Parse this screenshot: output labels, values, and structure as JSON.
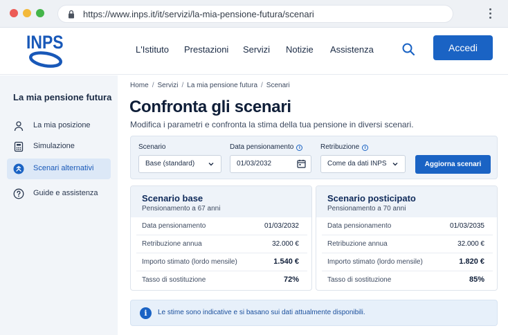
{
  "browser": {
    "url": "https://www.inps.it/it/servizi/la-mia-pensione-futura/scenari"
  },
  "header": {
    "logo_text": "INPS",
    "nav": [
      "L'Istituto",
      "Prestazioni",
      "Servizi",
      "Notizie",
      "Assistenza"
    ],
    "login_label": "Accedi"
  },
  "sidebar": {
    "title": "La mia pensione futura",
    "items": [
      {
        "label": "La mia posizione",
        "icon": "user-icon"
      },
      {
        "label": "Simulazione",
        "icon": "calculator-icon"
      },
      {
        "label": "Scenari alternativi",
        "icon": "branch-icon"
      },
      {
        "label": "Guide e assistenza",
        "icon": "help-icon"
      }
    ],
    "active_index": 2
  },
  "breadcrumb": [
    "Home",
    "Servizi",
    "La mia pensione futura",
    "Scenari"
  ],
  "page": {
    "title": "Confronta gli scenari",
    "subtitle": "Modifica i parametri e confronta la stima della tua pensione in diversi scenari."
  },
  "filters": {
    "scenario_label": "Scenario",
    "scenario_value": "Base (standard)",
    "date_label": "Data pensionamento",
    "date_value": "01/03/2032",
    "salary_label": "Retribuzione",
    "salary_value": "Come da dati INPS",
    "update_label": "Aggiorna scenari"
  },
  "scenarios": [
    {
      "title": "Scenario base",
      "subtitle": "Pensionamento a 67 anni",
      "rows": [
        {
          "label": "Data pensionamento",
          "value": "01/03/2032"
        },
        {
          "label": "Retribuzione annua",
          "value": "32.000 €"
        },
        {
          "label": "Importo stimato (lordo mensile)",
          "value": "1.540 €"
        },
        {
          "label": "Tasso di sostituzione",
          "value": "72%"
        }
      ]
    },
    {
      "title": "Scenario posticipato",
      "subtitle": "Pensionamento a 70 anni",
      "rows": [
        {
          "label": "Data pensionamento",
          "value": "01/03/2035"
        },
        {
          "label": "Retribuzione annua",
          "value": "32.000 €"
        },
        {
          "label": "Importo stimato (lordo mensile)",
          "value": "1.820 €"
        },
        {
          "label": "Tasso di sostituzione",
          "value": "85%"
        }
      ]
    }
  ],
  "notice": {
    "icon": "info-icon",
    "text": "Le stime sono indicative e si basano sui dati attualmente disponibili."
  },
  "colors": {
    "brand": "#1a63c4",
    "sidebar_bg": "#f2f5f9",
    "active_bg": "#dce8f7"
  }
}
